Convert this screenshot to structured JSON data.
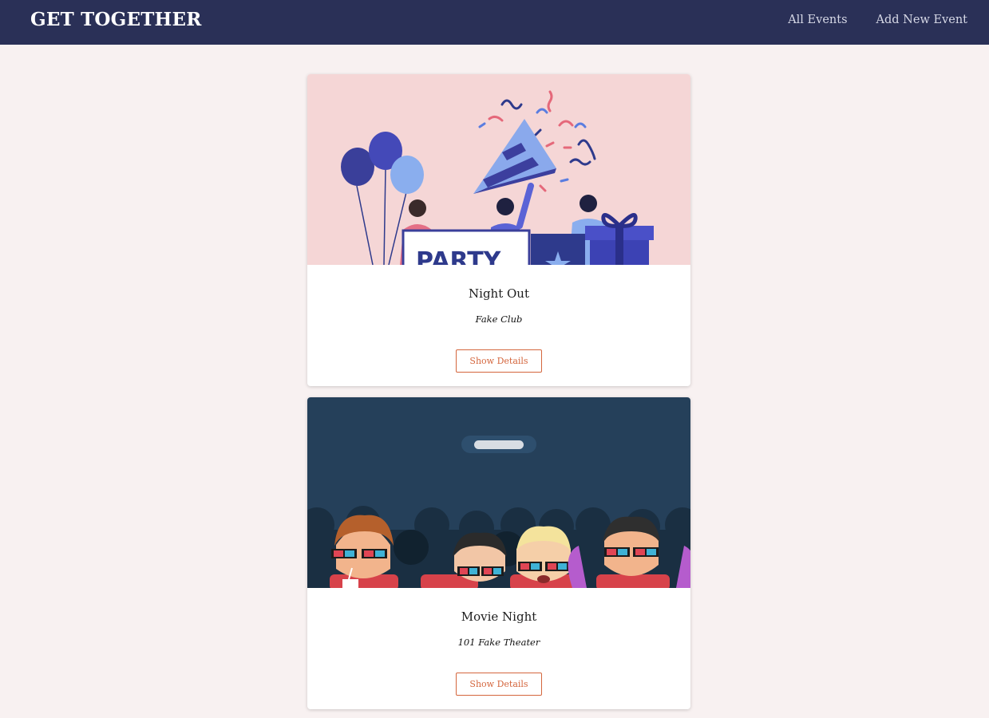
{
  "header": {
    "logo": "GET TOGETHER",
    "nav": [
      "All Events",
      "Add New Event"
    ]
  },
  "events": [
    {
      "title": "Night Out",
      "venue": "Fake Club",
      "button": "Show Details",
      "image_banner_text": "PARTY"
    },
    {
      "title": "Movie Night",
      "venue": "101 Fake Theater",
      "button": "Show Details"
    }
  ],
  "colors": {
    "header_bg": "#2a3057",
    "page_bg": "#f8f1f1",
    "accent": "#d4663d"
  }
}
